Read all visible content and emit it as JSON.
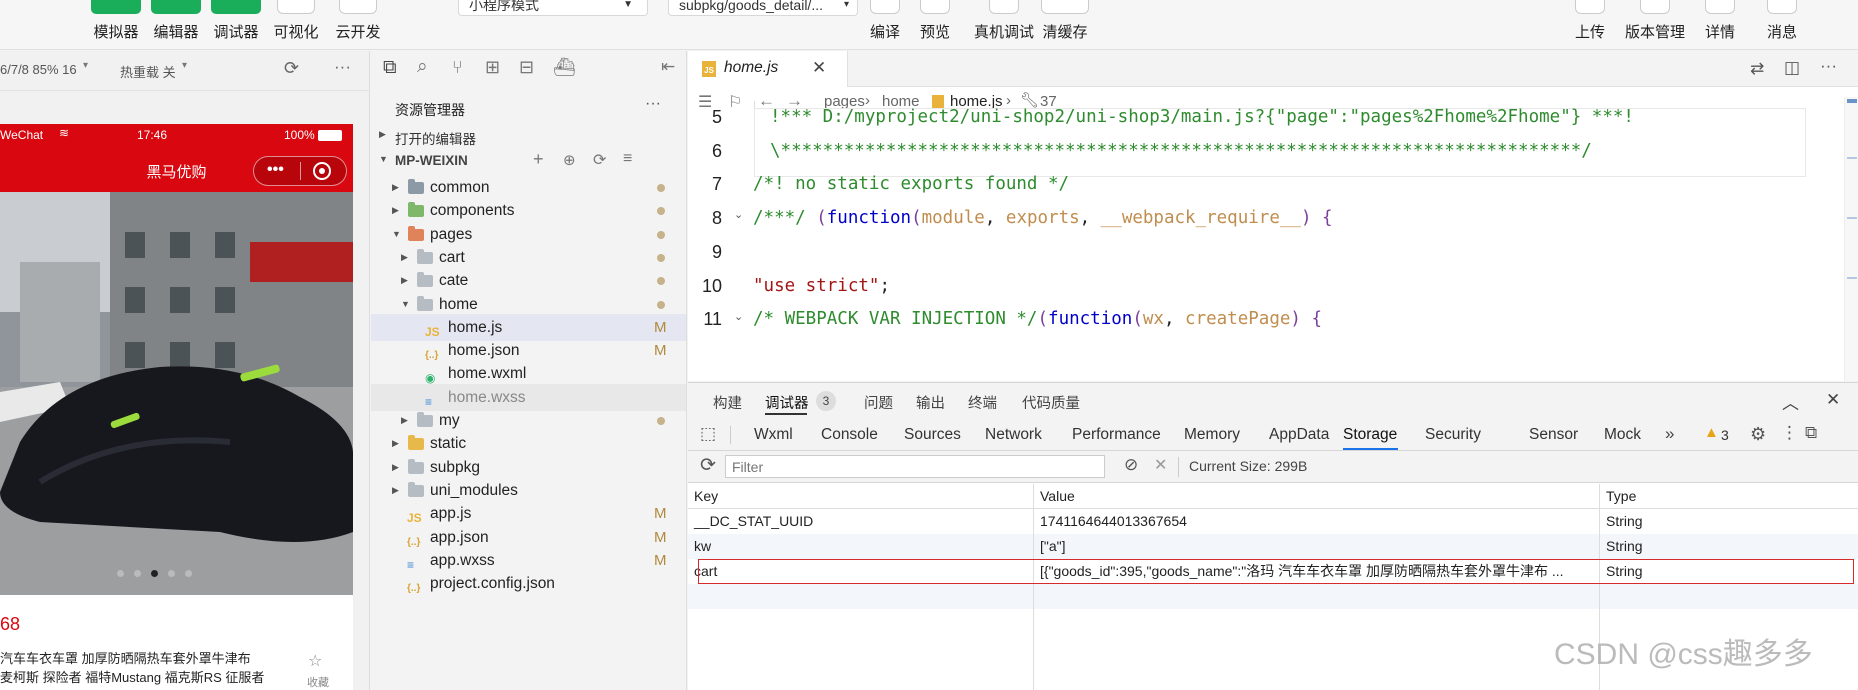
{
  "toolbar": {
    "left_buttons": [
      "模拟器",
      "编辑器",
      "调试器",
      "可视化",
      "云开发"
    ],
    "compile_mode": "小程序模式",
    "page_path": "subpkg/goods_detail/...",
    "mid_buttons": [
      "编译",
      "预览",
      "真机调试",
      "清缓存"
    ],
    "right_buttons": [
      "上传",
      "版本管理",
      "详情",
      "消息"
    ]
  },
  "simulator": {
    "device_info": "6/7/8 85% 16",
    "hot_reload": "热重载 关",
    "status": {
      "carrier": "WeChat",
      "time": "17:46",
      "battery": "100%"
    },
    "nav_title": "黑马优购",
    "price": "68",
    "goods_title": "汽车车衣车罩 加厚防晒隔热车套外罩牛津布",
    "goods_subtitle": "麦柯斯 探险者 福特Mustang 福克斯RS 征服者",
    "favorite": "收藏"
  },
  "explorer": {
    "title": "资源管理器",
    "open_editors": "打开的编辑器",
    "project": "MP-WEIXIN",
    "tree": [
      {
        "name": "common",
        "depth": 0,
        "kind": "folder",
        "color": "#8c9aa8",
        "twisty": "▸",
        "mark": "dot"
      },
      {
        "name": "components",
        "depth": 0,
        "kind": "folder",
        "color": "#7fb86b",
        "twisty": "▸",
        "mark": "dot"
      },
      {
        "name": "pages",
        "depth": 0,
        "kind": "folder",
        "color": "#e0835a",
        "twisty": "▾",
        "mark": "dot"
      },
      {
        "name": "cart",
        "depth": 1,
        "kind": "folder",
        "color": "#b6bcc4",
        "twisty": "▸",
        "mark": "dot"
      },
      {
        "name": "cate",
        "depth": 1,
        "kind": "folder",
        "color": "#b6bcc4",
        "twisty": "▸",
        "mark": "dot"
      },
      {
        "name": "home",
        "depth": 1,
        "kind": "folder",
        "color": "#b6bcc4",
        "twisty": "▾",
        "mark": "dot"
      },
      {
        "name": "home.js",
        "depth": 2,
        "kind": "js",
        "mark": "M",
        "state": "selected"
      },
      {
        "name": "home.json",
        "depth": 2,
        "kind": "json",
        "mark": "M"
      },
      {
        "name": "home.wxml",
        "depth": 2,
        "kind": "wxml"
      },
      {
        "name": "home.wxss",
        "depth": 2,
        "kind": "wxss",
        "state": "dim"
      },
      {
        "name": "my",
        "depth": 1,
        "kind": "folder",
        "color": "#b6bcc4",
        "twisty": "▸",
        "mark": "dot"
      },
      {
        "name": "static",
        "depth": 0,
        "kind": "folder",
        "color": "#e6b94a",
        "twisty": "▸"
      },
      {
        "name": "subpkg",
        "depth": 0,
        "kind": "folder",
        "color": "#b6bcc4",
        "twisty": "▸"
      },
      {
        "name": "uni_modules",
        "depth": 0,
        "kind": "folder",
        "color": "#b6bcc4",
        "twisty": "▸"
      },
      {
        "name": "app.js",
        "depth": 0,
        "kind": "js",
        "mark": "M"
      },
      {
        "name": "app.json",
        "depth": 0,
        "kind": "json",
        "mark": "M"
      },
      {
        "name": "app.wxss",
        "depth": 0,
        "kind": "wxss",
        "mark": "M"
      },
      {
        "name": "project.config.json",
        "depth": 0,
        "kind": "json"
      }
    ]
  },
  "editor": {
    "tab_label": "home.js",
    "breadcrumb": [
      "pages",
      "home",
      "home.js",
      "37"
    ],
    "lines": [
      {
        "n": "5",
        "parts": [
          [
            "!*** D:/myproject2/uni-shop2/uni-shop3/main.js?{\"page\":\"pages%2Fhome%2Fhome\"} ***!",
            "#2e8b2e"
          ]
        ]
      },
      {
        "n": "6",
        "parts": [
          [
            "\\****************************************************************************/",
            "#2e8b2e"
          ]
        ]
      },
      {
        "n": "7",
        "parts": [
          [
            "/*! no static exports found */",
            "#2e8b2e"
          ]
        ]
      },
      {
        "n": "8",
        "parts": [
          [
            "/***/ ",
            "#2e8b2e"
          ],
          [
            "(",
            "#7a3e9d"
          ],
          [
            "function",
            "#0000c8"
          ],
          [
            "(",
            "#7a3e9d"
          ],
          [
            "module",
            "#c08d4e"
          ],
          [
            ", ",
            "#222222"
          ],
          [
            "exports",
            "#c08d4e"
          ],
          [
            ", ",
            "#222222"
          ],
          [
            "__webpack_require__",
            "#c08d4e"
          ],
          [
            ") {",
            "#7a3e9d"
          ]
        ]
      },
      {
        "n": "9",
        "parts": []
      },
      {
        "n": "10",
        "parts": [
          [
            "\"use strict\"",
            "#a31515"
          ],
          [
            ";",
            "#222222"
          ]
        ]
      },
      {
        "n": "11",
        "parts": [
          [
            "/* WEBPACK VAR INJECTION */",
            "#2e8b2e"
          ],
          [
            "(",
            "#7a3e9d"
          ],
          [
            "function",
            "#0000c8"
          ],
          [
            "(",
            "#7a3e9d"
          ],
          [
            "wx",
            "#c08d4e"
          ],
          [
            ", ",
            "#222222"
          ],
          [
            "createPage",
            "#c08d4e"
          ],
          [
            ") {",
            "#7a3e9d"
          ]
        ]
      }
    ]
  },
  "devtools": {
    "top_tabs": [
      "构建",
      "调试器",
      "问题",
      "输出",
      "终端",
      "代码质量"
    ],
    "debugger_badge": "3",
    "panel_tabs": [
      "Wxml",
      "Console",
      "Sources",
      "Network",
      "Performance",
      "Memory",
      "AppData",
      "Storage",
      "Security",
      "Sensor",
      "Mock"
    ],
    "warn_count": "3",
    "filter_placeholder": "Filter",
    "current_size": "Current Size: 299B",
    "columns": [
      "Key",
      "Value",
      "Type"
    ],
    "rows": [
      [
        "__DC_STAT_UUID",
        "1741164644013367654",
        "String"
      ],
      [
        "kw",
        "[\"a\"]",
        "String"
      ],
      [
        "cart",
        "[{\"goods_id\":395,\"goods_name\":\"洛玛 汽车车衣车罩 加厚防晒隔热车套外罩牛津布 ...",
        "String"
      ]
    ],
    "highlight_color": "#d62b2b"
  },
  "watermark": "CSDN @css趣多多"
}
